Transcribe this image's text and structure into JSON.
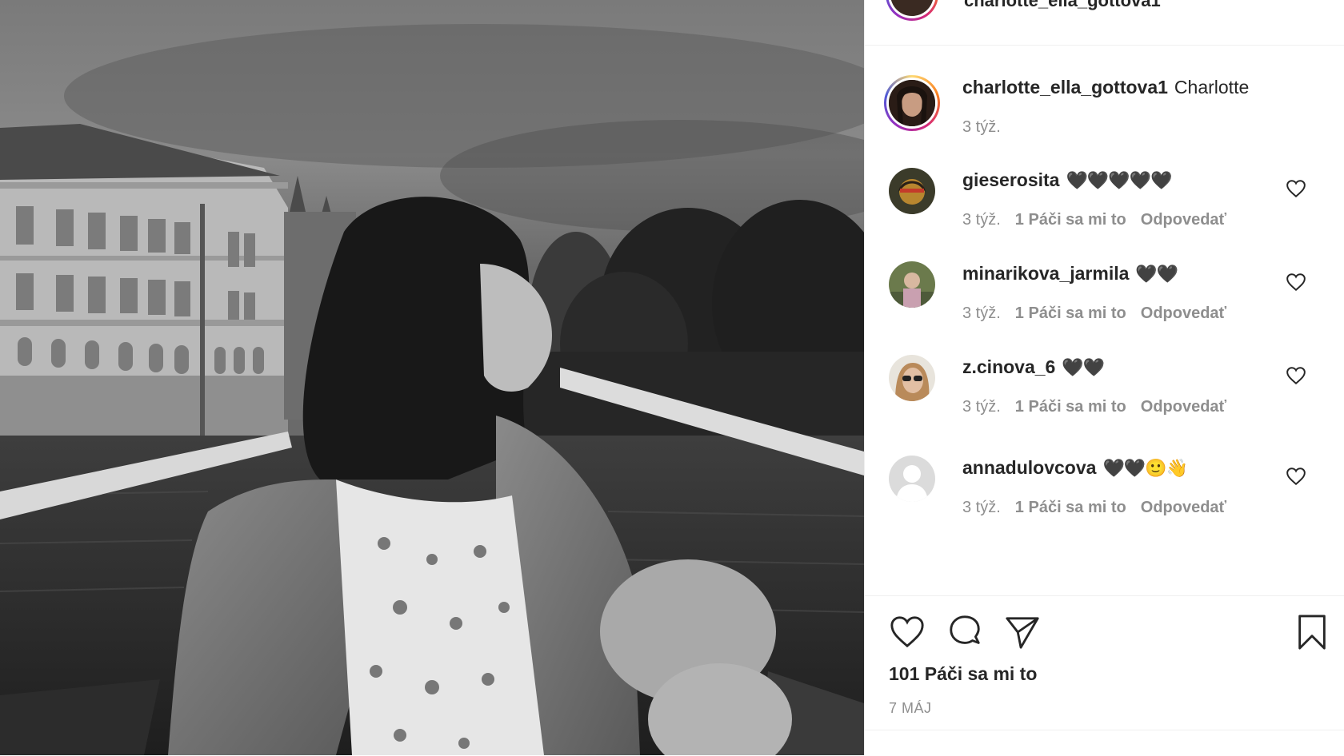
{
  "post": {
    "header_username": "charlotte_ella_gottova1",
    "author": "charlotte_ella_gottova1",
    "caption": "Charlotte",
    "caption_time": "3 týž.",
    "likes_count": "101 Páči sa mi to",
    "date": "7 MÁJ"
  },
  "comments": [
    {
      "username": "gieserosita",
      "text": "🖤🖤🖤🖤🖤",
      "time": "3 týž.",
      "likes": "1 Páči sa mi to",
      "reply": "Odpovedať"
    },
    {
      "username": "minarikova_jarmila",
      "text": "🖤🖤",
      "time": "3 týž.",
      "likes": "1 Páči sa mi to",
      "reply": "Odpovedať"
    },
    {
      "username": "z.cinova_6",
      "text": "🖤🖤",
      "time": "3 týž.",
      "likes": "1 Páči sa mi to",
      "reply": "Odpovedať"
    },
    {
      "username": "annadulovcova",
      "text": "🖤🖤🙂👋",
      "time": "3 týž.",
      "likes": "1 Páči sa mi to",
      "reply": "Odpovedať"
    }
  ],
  "icons": {
    "like": "heart-icon",
    "comment": "comment-icon",
    "share": "paper-plane-icon",
    "save": "bookmark-icon"
  },
  "colors": {
    "text": "#262626",
    "muted": "#8e8e8e",
    "divider": "#efefef"
  }
}
